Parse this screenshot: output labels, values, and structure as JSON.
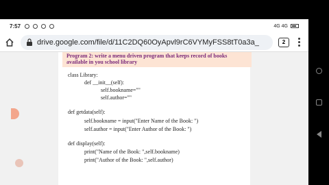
{
  "status": {
    "time": "7:57",
    "right_text": "4G 4G"
  },
  "browser": {
    "url": "drive.google.com/file/d/11C2DQ60OyApvl9rC6VYMyFSS8tT0a3a_",
    "tab_count": "2"
  },
  "document": {
    "heading_line1": "Program 2: write a menu driven program that keeps record of books",
    "heading_line2": "available in you school library",
    "code_lines": [
      "class Library:",
      "def __init__(self):",
      "self.bookname=\"\"",
      "self.author=\"\"",
      "def getdata(self):",
      "self.bookname = input(\"Enter Name of the Book: \")",
      "self.author = input(\"Enter Author of the Book: \")",
      "def display(self):",
      "print(\"Name of the Book: \",self.bookname)",
      "print(\"Author of the Book: \",self.author)"
    ]
  }
}
